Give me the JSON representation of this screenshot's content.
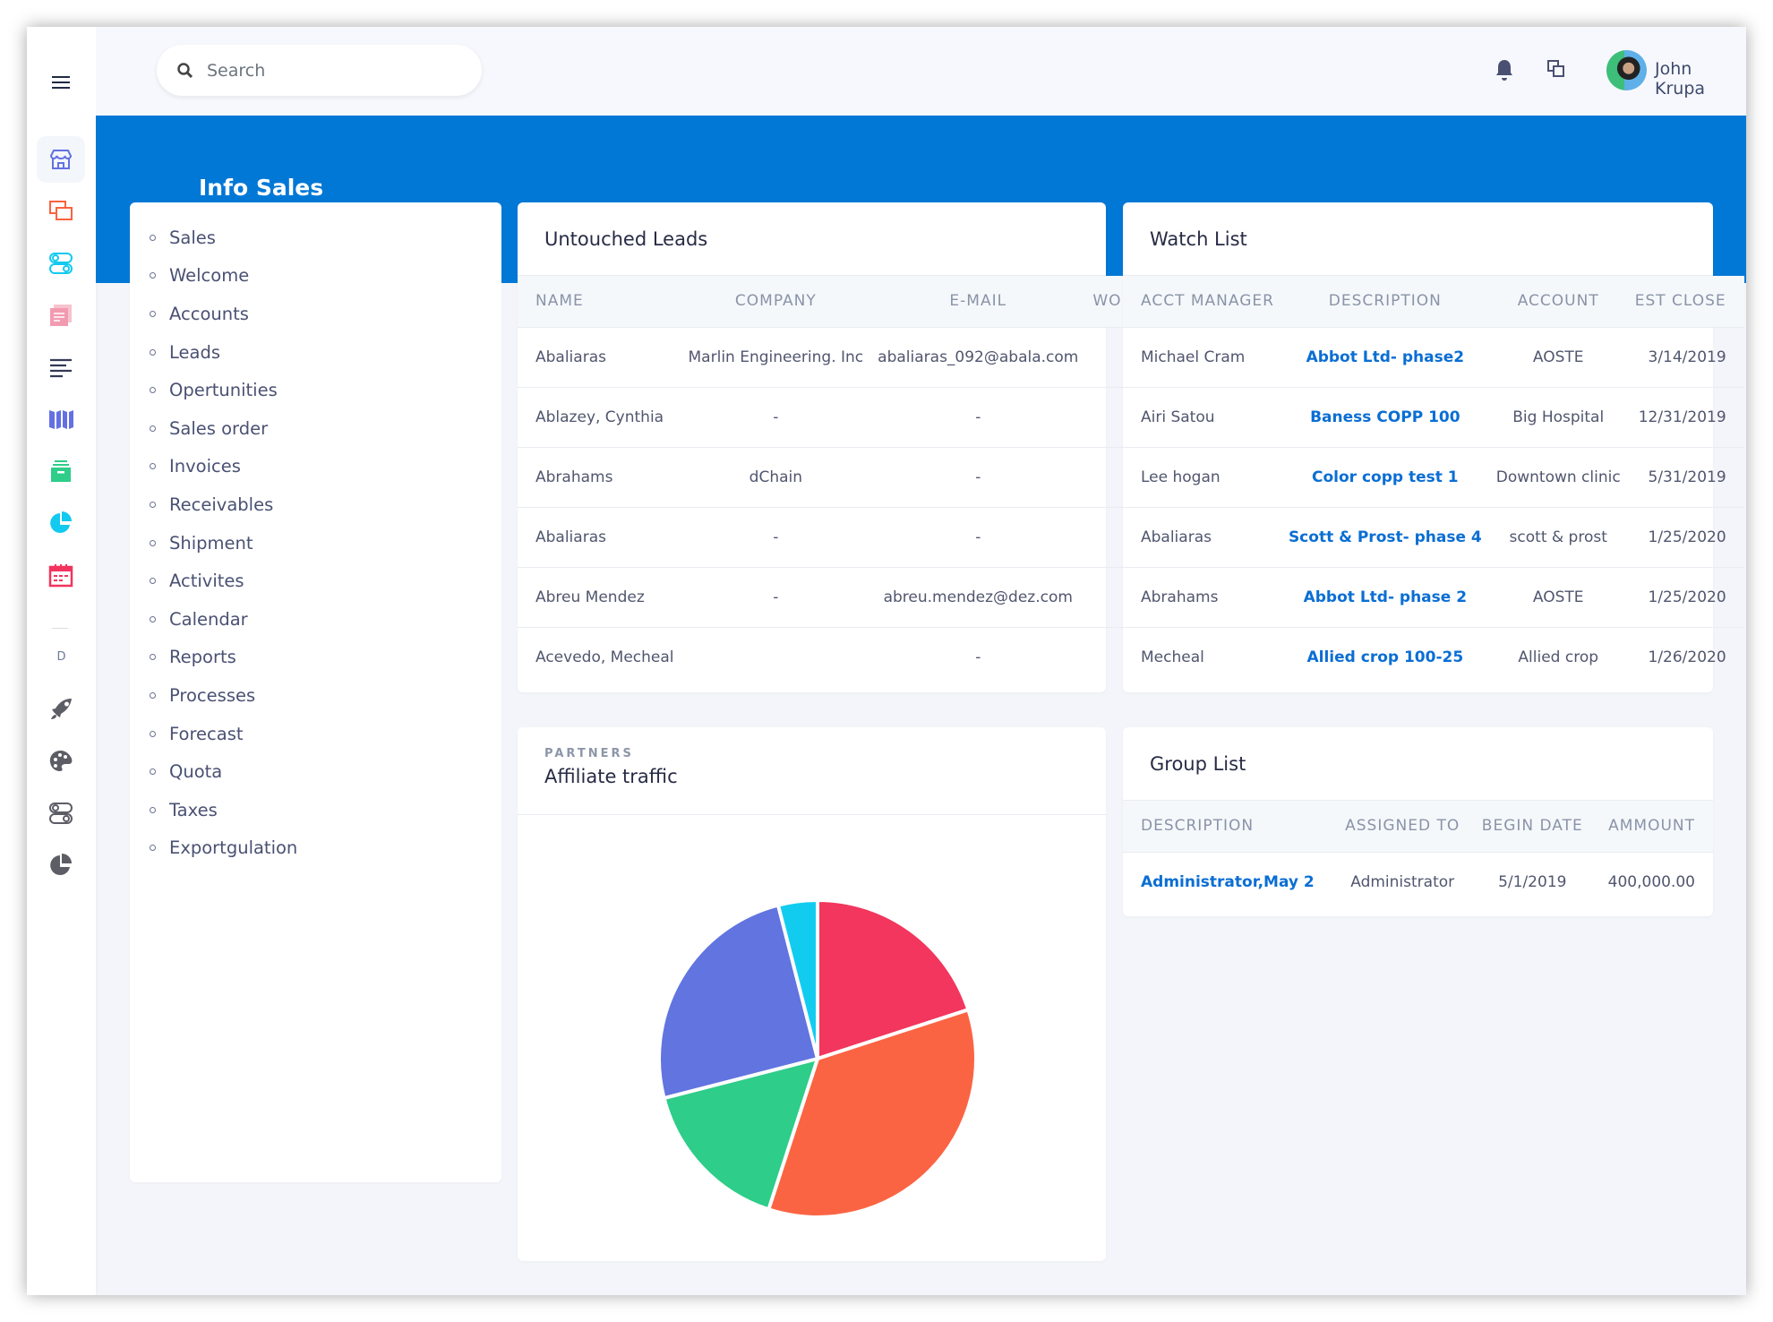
{
  "header": {
    "search_placeholder": "Search",
    "user_name": "John Krupa"
  },
  "sidebar": {
    "section_label": "D",
    "icons": [
      "menu-icon",
      "store-icon",
      "windows-icon",
      "toggles-icon",
      "documents-icon",
      "text-align-icon",
      "map-icon",
      "archive-icon",
      "pie-chart-icon",
      "calendar-icon",
      "rocket-icon",
      "palette-icon",
      "toggles-icon",
      "pie-chart-icon"
    ],
    "colors": {
      "store": "#6370e3",
      "windows": "#fb623f",
      "toggles": "#12c9f0",
      "documents": "#f5a1b4",
      "text": "#343a56",
      "map": "#6370e3",
      "archive": "#2ecd89",
      "pie": "#12c9f0",
      "calendar": "#f3345e",
      "gray": "#5d5d66"
    }
  },
  "page": {
    "title": "Info Sales",
    "accent": "#0278d6"
  },
  "menu": {
    "items": [
      "Sales",
      "Welcome",
      "Accounts",
      "Leads",
      "Opertunities",
      "Sales order",
      "Invoices",
      "Receivables",
      "Shipment",
      "Activites",
      "Calendar",
      "Reports",
      "Processes",
      "Forecast",
      "Quota",
      "Taxes",
      "Exportgulation"
    ]
  },
  "leads": {
    "title": "Untouched Leads",
    "columns": [
      "Name",
      "Company",
      "E-mail",
      "Work Phone"
    ],
    "rows": [
      [
        "Abaliaras",
        "Marlin Engineering. Inc",
        "abaliaras_092@abala.com",
        "-"
      ],
      [
        "Ablazey, Cynthia",
        "-",
        "-",
        "-"
      ],
      [
        "Abrahams",
        "dChain",
        "-",
        "-"
      ],
      [
        "Abaliaras",
        "-",
        "-",
        "-"
      ],
      [
        "Abreu Mendez",
        "-",
        "abreu.mendez@dez.com",
        "-"
      ],
      [
        "Acevedo, Mecheal",
        "",
        "-",
        "-"
      ]
    ]
  },
  "watch": {
    "title": "Watch List",
    "columns": [
      "Acct Manager",
      "Description",
      "Account",
      "Est Close"
    ],
    "rows": [
      [
        "Michael Cram",
        "Abbot Ltd- phase2",
        "AOSTE",
        "3/14/2019"
      ],
      [
        "Airi Satou",
        "Baness COPP 100",
        "Big Hospital",
        "12/31/2019"
      ],
      [
        "Lee hogan",
        "Color copp test 1",
        "Downtown clinic",
        "5/31/2019"
      ],
      [
        "Abaliaras",
        "Scott & Prost- phase 4",
        "scott & prost",
        "1/25/2020"
      ],
      [
        "Abrahams",
        "Abbot Ltd- phase 2",
        "AOSTE",
        "1/25/2020"
      ],
      [
        "Mecheal",
        "Allied crop 100-25",
        "Allied crop",
        "1/26/2020"
      ]
    ]
  },
  "traffic": {
    "subtitle": "PARTNERS",
    "title": "Affiliate traffic"
  },
  "group": {
    "title": "Group List",
    "columns": [
      "Description",
      "Assigned To",
      "Begin Date",
      "Ammount"
    ],
    "rows": [
      [
        "Administrator,May 2",
        "Administrator",
        "5/1/2019",
        "400,000.00"
      ]
    ]
  },
  "chart_data": {
    "type": "pie",
    "title": "Affiliate traffic",
    "start": "top",
    "direction": "clockwise",
    "values": [
      20,
      35,
      16,
      25,
      4
    ],
    "colors": [
      "#f2365d",
      "#fb6443",
      "#2ecd89",
      "#6174e0",
      "#12ccf0"
    ]
  }
}
